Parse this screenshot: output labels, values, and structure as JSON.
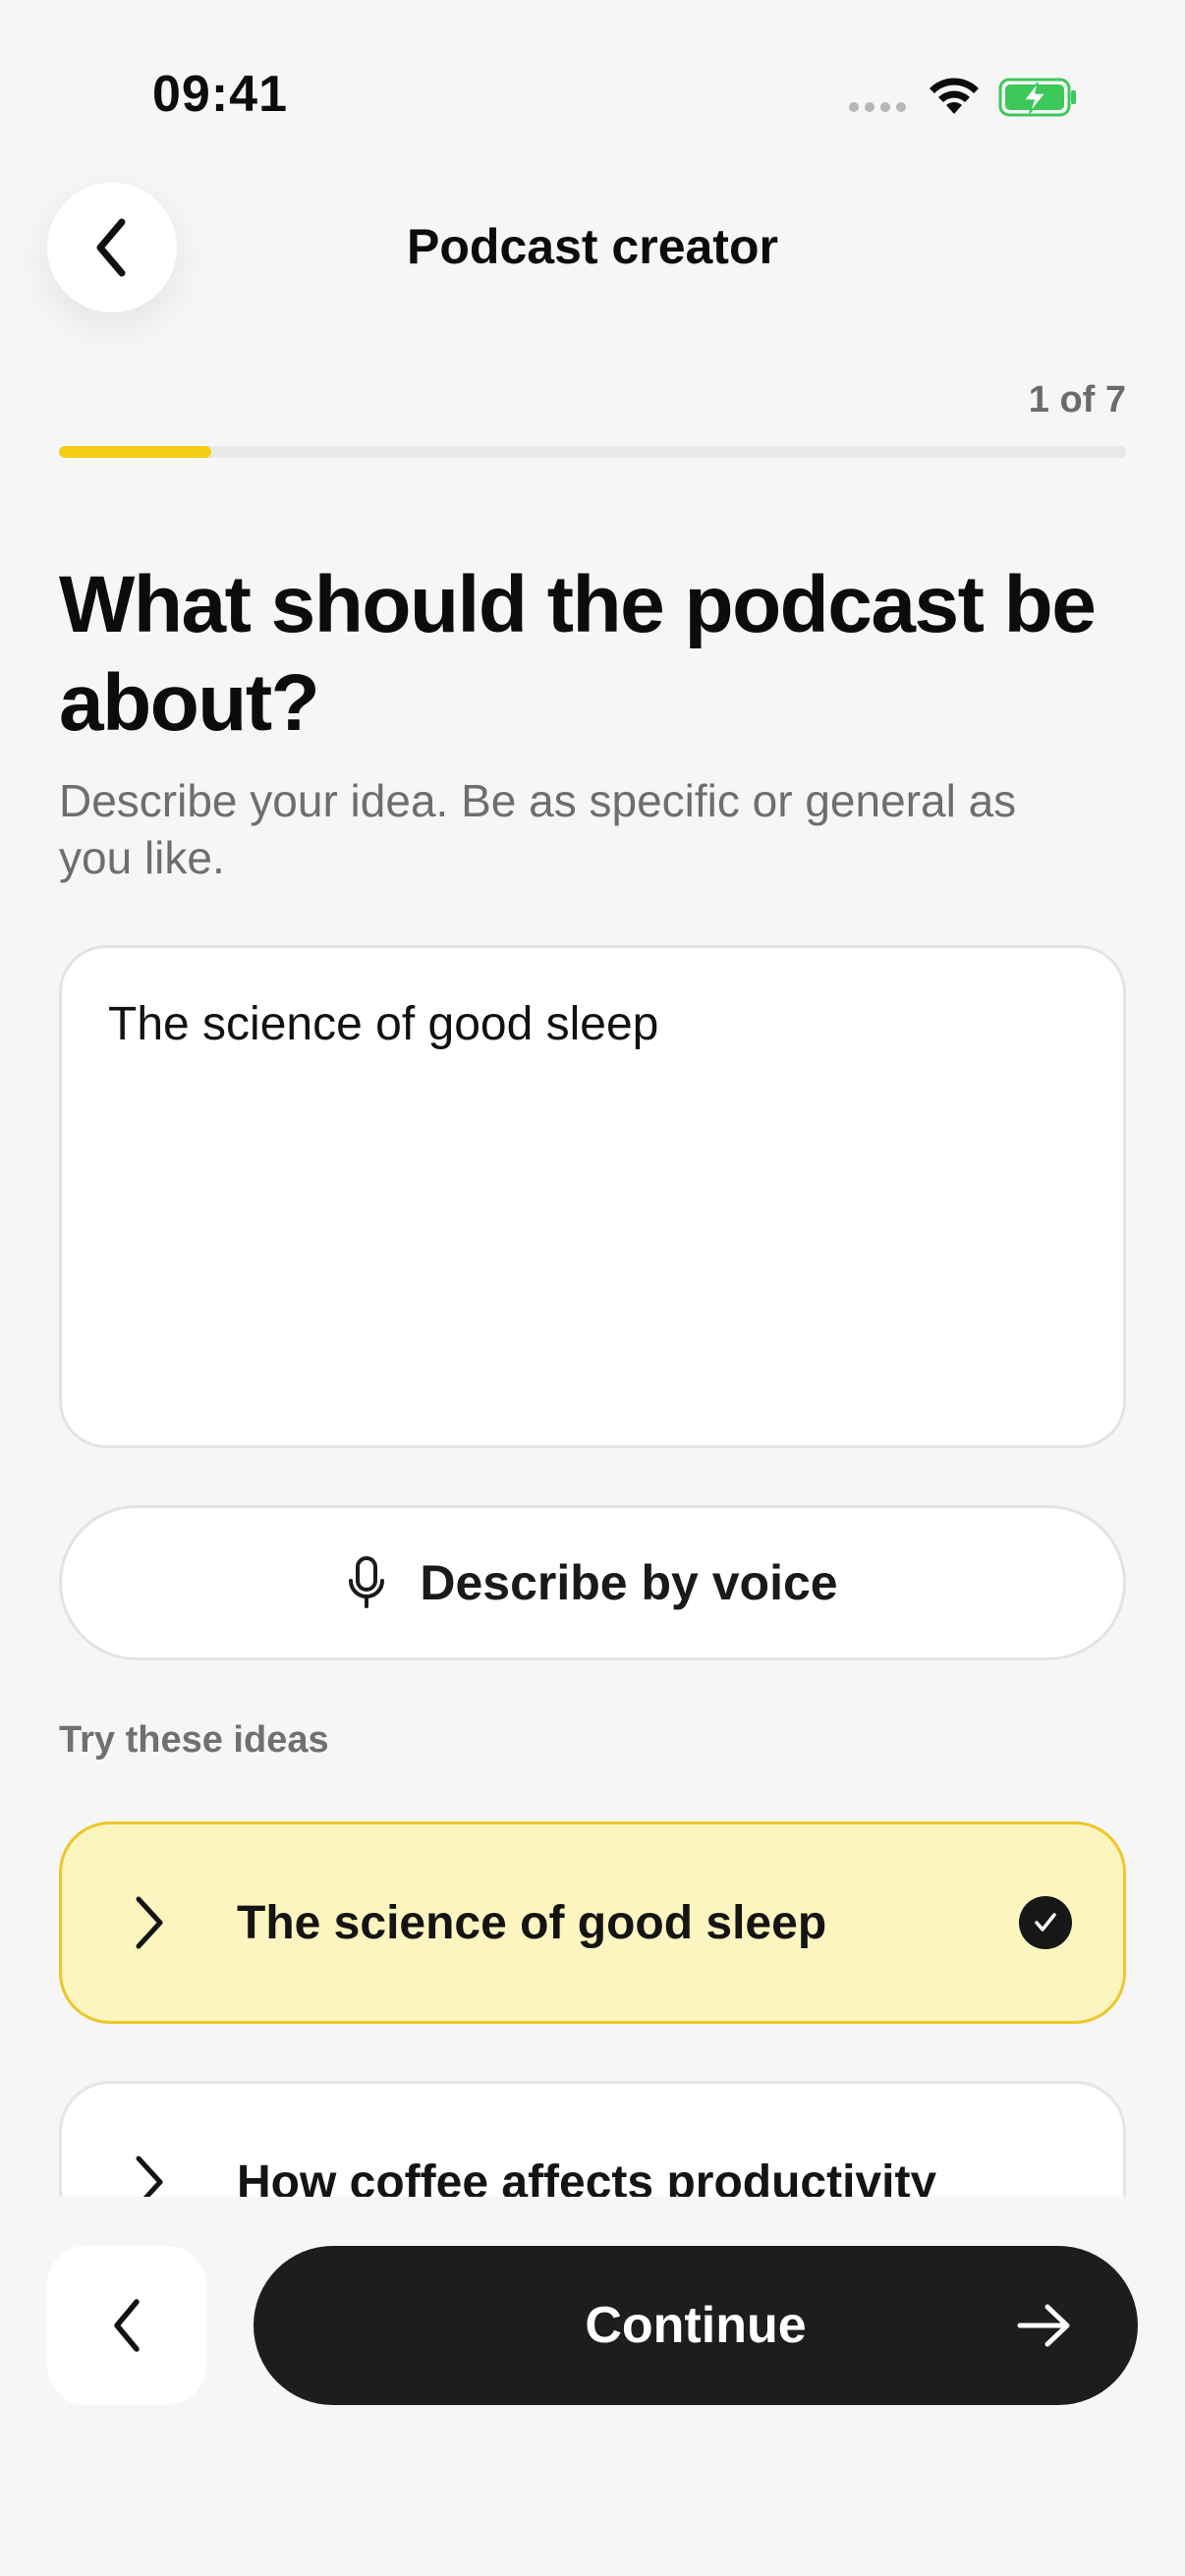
{
  "status_bar": {
    "time": "09:41",
    "icons": [
      "signal-dots-icon",
      "wifi-icon",
      "battery-charging-icon"
    ],
    "battery_color": "#3dc85a"
  },
  "header": {
    "title": "Podcast creator",
    "back_icon": "chevron-left-icon"
  },
  "progress": {
    "label": "1 of 7",
    "current_step": 1,
    "total_steps": 7,
    "fraction": 0.143,
    "fill_color": "#f3cd12"
  },
  "question": {
    "title": "What should the podcast be about?",
    "subtitle": "Describe your idea. Be as specific or general as you like."
  },
  "idea_input": {
    "value": "The science of good sleep"
  },
  "voice_button": {
    "label": "Describe by voice",
    "icon": "microphone-icon"
  },
  "ideas": {
    "label": "Try these ideas",
    "items": [
      {
        "label": "The science of good sleep",
        "selected": true
      },
      {
        "label": "How coffee affects productivity",
        "selected": false
      }
    ],
    "selected_bg": "#fdf5bf",
    "selected_border": "#ecc72a"
  },
  "footer": {
    "back_icon": "chevron-left-icon",
    "continue_label": "Continue",
    "continue_icon": "arrow-right-icon"
  }
}
